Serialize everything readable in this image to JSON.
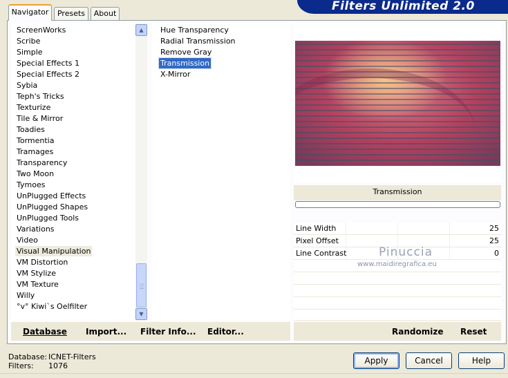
{
  "window": {
    "title": "Filters Unlimited 2.0"
  },
  "tabs": [
    {
      "label": "Navigator",
      "active": true
    },
    {
      "label": "Presets",
      "active": false
    },
    {
      "label": "About",
      "active": false
    }
  ],
  "categories": {
    "items": [
      "ScreenWorks",
      "Scribe",
      "Simple",
      "Special Effects 1",
      "Special Effects 2",
      "Sybia",
      "Teph's Tricks",
      "Texturize",
      "Tile & Mirror",
      "Toadies",
      "Tormentia",
      "Tramages",
      "Transparency",
      "Two Moon",
      "Tymoes",
      "UnPlugged Effects",
      "UnPlugged Shapes",
      "UnPlugged Tools",
      "Variations",
      "Video",
      "Visual Manipulation",
      "VM Distortion",
      "VM Stylize",
      "VM Texture",
      "Willy",
      "°v° Kiwi`s Oelfilter"
    ],
    "selected": "Visual Manipulation",
    "up_arrow": "scroll-up-arrow-icon",
    "down_arrow": "scroll-down-arrow-icon"
  },
  "filters": {
    "items": [
      "Hue Transparency",
      "Radial Transmission",
      "Remove Gray",
      "Transmission",
      "X-Mirror"
    ],
    "selected": "Transmission"
  },
  "preview": {
    "filter_name": "Transmission"
  },
  "params": [
    {
      "label": "Line Width",
      "value": "25"
    },
    {
      "label": "Pixel Offset",
      "value": "25"
    },
    {
      "label": "Line Contrast",
      "value": "0"
    }
  ],
  "watermark": {
    "name": "Pinuccia",
    "url": "www.maidiregrafica.eu"
  },
  "toolbar_left": {
    "database": "Database",
    "import": "Import...",
    "filter_info": "Filter Info...",
    "editor": "Editor..."
  },
  "toolbar_right": {
    "randomize": "Randomize",
    "reset": "Reset"
  },
  "status": {
    "database_label": "Database:",
    "database_value": "ICNET-Filters",
    "filters_label": "Filters:",
    "filters_value": "1076"
  },
  "buttons": {
    "apply": "Apply",
    "cancel": "Cancel",
    "help": "Help"
  },
  "colors": {
    "banner": "#0a2a8c",
    "selection": "#316ac5",
    "panel_bg": "#ece9d8"
  }
}
